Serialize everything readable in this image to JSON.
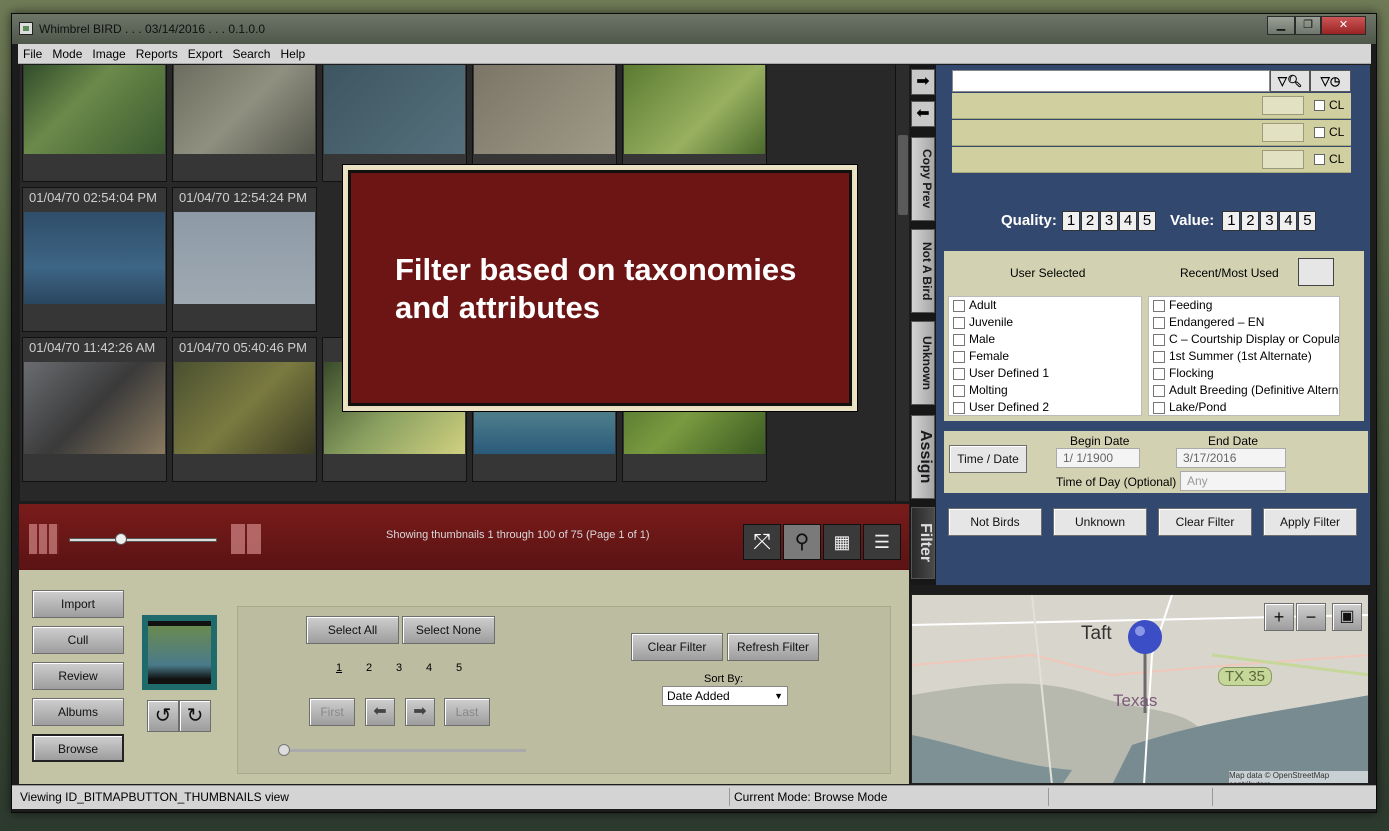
{
  "window": {
    "title": "Whimbrel BIRD . . . 03/14/2016 . . . 0.1.0.0",
    "controls": [
      "minimize",
      "restore",
      "close"
    ]
  },
  "menu": [
    "File",
    "Mode",
    "Image",
    "Reports",
    "Export",
    "Search",
    "Help"
  ],
  "thumbnails": {
    "timestamps": [
      "01/04/70 02:54:04 PM",
      "01/04/70 12:54:24 PM",
      "01/04/70 11:42:26 AM",
      "01/04/70 05:40:46 PM"
    ],
    "showing_text": "Showing thumbnails 1 through 100 of 75 (Page 1 of 1)"
  },
  "overlay": {
    "text": "Filter based on taxonomies and attributes"
  },
  "left_buttons": [
    "Import",
    "Cull",
    "Review",
    "Albums",
    "Browse"
  ],
  "selection": {
    "select_all": "Select All",
    "select_none": "Select None",
    "pages": [
      "1",
      "2",
      "3",
      "4",
      "5"
    ],
    "first": "First",
    "last": "Last",
    "clear_filter": "Clear Filter",
    "refresh_filter": "Refresh Filter",
    "sort_label": "Sort By:",
    "sort_value": "Date Added"
  },
  "status": {
    "left": "Viewing ID_BITMAPBUTTON_THUMBNAILS view",
    "mode": "Current Mode: Browse Mode"
  },
  "side_tabs": [
    "Copy Prev",
    "Not A Bird",
    "Unknown",
    "Assign",
    "Filter"
  ],
  "tag_rows": [
    {
      "cl": "CL"
    },
    {
      "cl": "CL"
    },
    {
      "cl": "CL"
    }
  ],
  "ratings": {
    "quality_label": "Quality:",
    "value_label": "Value:",
    "scale": [
      "1",
      "2",
      "3",
      "4",
      "5"
    ]
  },
  "attributes": {
    "user_selected_label": "User Selected",
    "recent_label": "Recent/Most Used",
    "user_selected": [
      "Adult",
      "Juvenile",
      "Male",
      "Female",
      "User Defined 1",
      "Molting",
      "User Defined 2"
    ],
    "recent": [
      "Feeding",
      "Endangered – EN",
      "C – Courtship Display or Copulation",
      "1st Summer (1st Alternate)",
      "Flocking",
      "Adult Breeding (Definitive Alternate)",
      "Lake/Pond"
    ]
  },
  "date": {
    "time_date_button": "Time / Date",
    "begin_label": "Begin Date",
    "end_label": "End Date",
    "begin_value": "1/  1/1900",
    "end_value": "3/17/2016",
    "time_of_day_label": "Time of Day (Optional)",
    "time_of_day_value": "Any"
  },
  "filter_buttons": [
    "Not Birds",
    "Unknown",
    "Clear Filter",
    "Apply Filter"
  ],
  "map": {
    "city": "Taft",
    "state": "Texas",
    "road": "TX 35",
    "attribution": "Map data © OpenStreetMap contributors"
  },
  "colors": {
    "panel_blue": "#33486e",
    "toolbar_red": "#6d1515",
    "tag_yellow": "#cfcf9f",
    "panel_olive": "#c3c3a6"
  }
}
